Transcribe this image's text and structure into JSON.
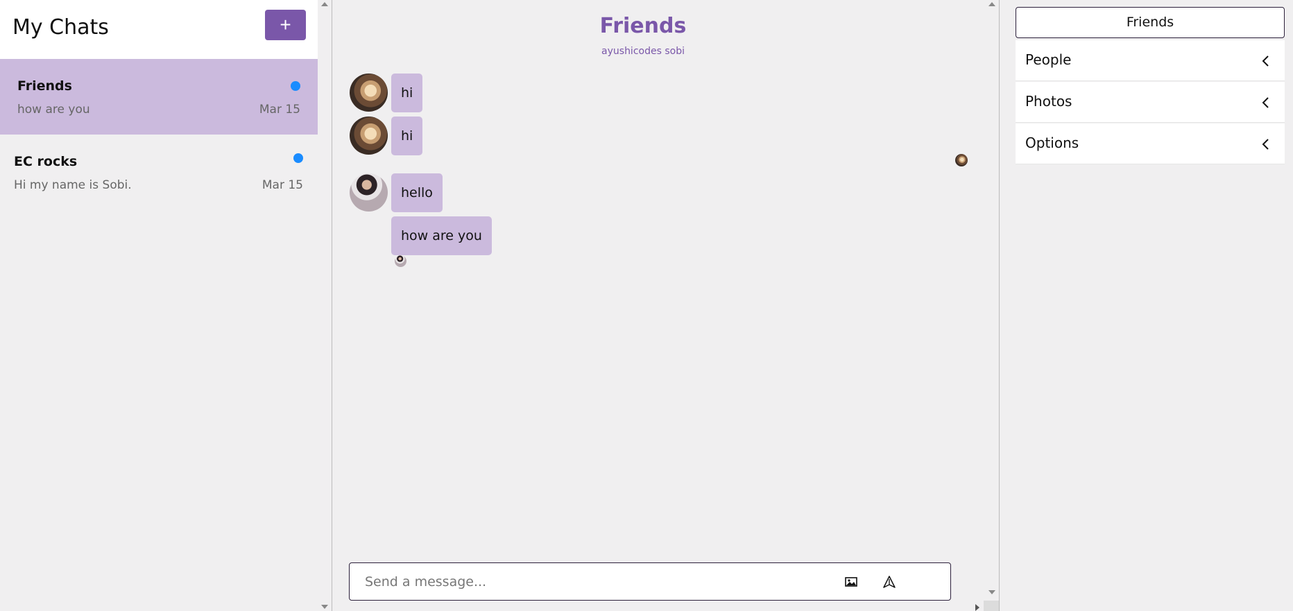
{
  "left": {
    "title": "My Chats",
    "new_button": "+",
    "chats": [
      {
        "name": "Friends",
        "preview": "how are you",
        "date": "Mar 15",
        "unread": true,
        "active": true
      },
      {
        "name": "EC rocks",
        "preview": "Hi my name is Sobi.",
        "date": "Mar 15",
        "unread": true,
        "active": false
      }
    ]
  },
  "chat": {
    "title": "Friends",
    "subtitle": "ayushicodes sobi",
    "messages": [
      {
        "text": "hi",
        "sender": "bear"
      },
      {
        "text": "hi",
        "sender": "bear"
      },
      {
        "text": "hello",
        "sender": "girl"
      },
      {
        "text": "how are you",
        "sender": "girl"
      }
    ],
    "composer": {
      "placeholder": "Send a message..."
    }
  },
  "right": {
    "title": "Friends",
    "items": [
      {
        "label": "People"
      },
      {
        "label": "Photos"
      },
      {
        "label": "Options"
      }
    ]
  },
  "colors": {
    "accent": "#7a57a9",
    "bubble": "#cbbadd",
    "unread": "#1a8cff",
    "background": "#f0eff0"
  },
  "icons": [
    "plus-icon",
    "image-icon",
    "send-icon",
    "chevron-left-icon"
  ]
}
